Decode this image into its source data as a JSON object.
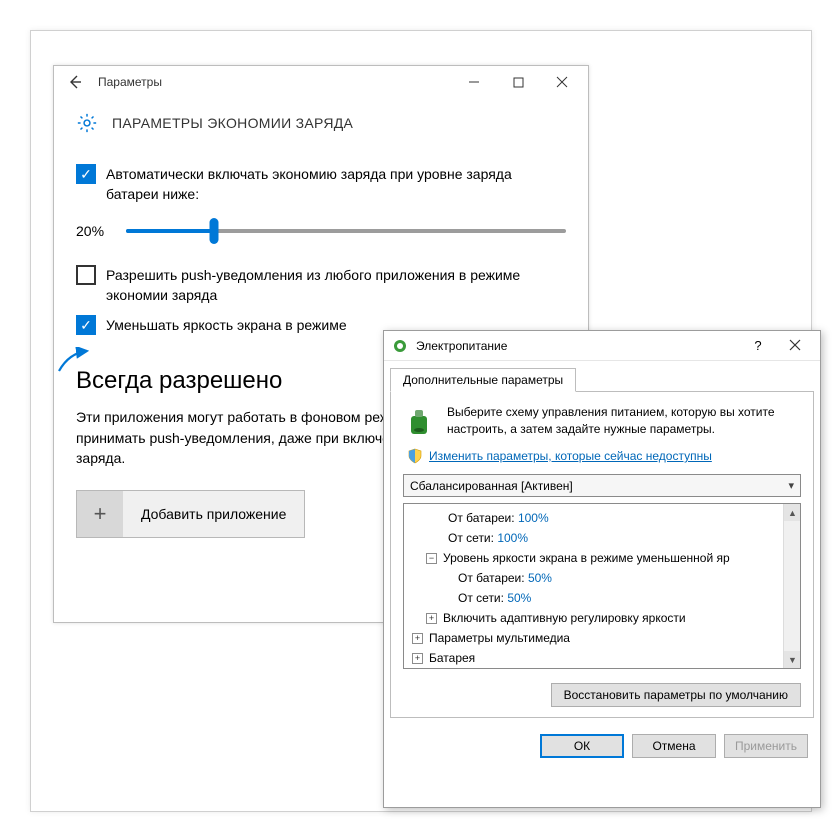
{
  "settings": {
    "window_title": "Параметры",
    "heading": "ПАРАМЕТРЫ ЭКОНОМИИ ЗАРЯДА",
    "auto_enable_label": "Автоматически включать экономию заряда при уровне заряда батареи ниже:",
    "slider_value": "20%",
    "slider_percent": 20,
    "allow_push_label": "Разрешить push-уведомления из любого приложения в режиме экономии заряда",
    "dim_screen_label": "Уменьшать яркость экрана в режиме",
    "always_allowed_title": "Всегда разрешено",
    "always_allowed_desc": "Эти приложения могут работать в фоновом режиме, а также отправлять и принимать push-уведомления, даже при включенной функции экономии заряда.",
    "add_app_label": "Добавить приложение"
  },
  "power": {
    "title": "Электропитание",
    "tab": "Дополнительные параметры",
    "desc": "Выберите схему управления питанием, которую вы хотите настроить, а затем задайте нужные параметры.",
    "link": "Изменить параметры, которые сейчас недоступны",
    "plan": "Сбалансированная [Активен]",
    "tree": {
      "on_battery_label": "От батареи:",
      "on_battery_100": "100%",
      "on_ac_label": "От сети:",
      "on_ac_100": "100%",
      "brightness_node": "Уровень яркости экрана в режиме уменьшенной яр",
      "on_battery_50": "50%",
      "on_ac_50": "50%",
      "adaptive": "Включить адаптивную регулировку яркости",
      "multimedia": "Параметры мультимедиа",
      "battery": "Батарея"
    },
    "restore": "Восстановить параметры по умолчанию",
    "ok": "ОК",
    "cancel": "Отмена",
    "apply": "Применить"
  }
}
